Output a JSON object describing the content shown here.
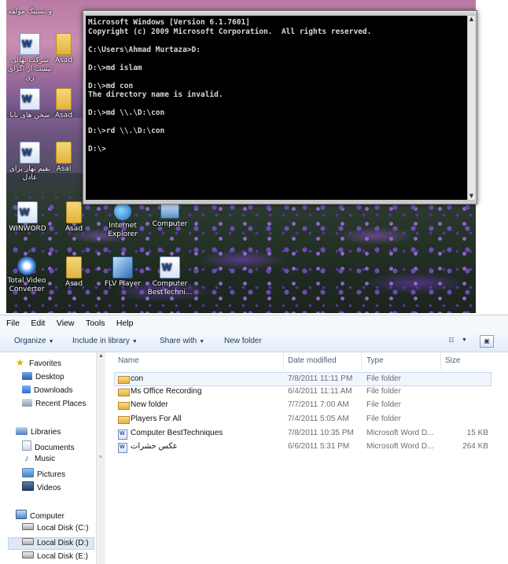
{
  "desktop": {
    "top_caption": "و تستیک مولفه",
    "icons": [
      {
        "label": "شرکت نهالی نیست ار اگرای ری",
        "kind": "word"
      },
      {
        "label": "Asad",
        "kind": "folder"
      },
      {
        "label": "سخن های نابا",
        "kind": "word"
      },
      {
        "label": "Asad",
        "kind": "folder"
      },
      {
        "label": "تقیم نهار برای عادل",
        "kind": "word"
      },
      {
        "label": "Asal",
        "kind": "folder"
      },
      {
        "label": "WINWORD",
        "kind": "word"
      },
      {
        "label": "Asad",
        "kind": "folder"
      },
      {
        "label": "Internet Explorer",
        "kind": "ie"
      },
      {
        "label": "Computer",
        "kind": "computer"
      },
      {
        "label": "Total Video Converter",
        "kind": "app"
      },
      {
        "label": "Asad",
        "kind": "folder"
      },
      {
        "label": "FLV Player",
        "kind": "flv"
      },
      {
        "label": "Computer BestTechni...",
        "kind": "word"
      }
    ]
  },
  "console": {
    "lines": [
      "Microsoft Windows [Version 6.1.7601]",
      "Copyright (c) 2009 Microsoft Corporation.  All rights reserved.",
      "",
      "C:\\Users\\Ahmad Murtaza>D:",
      "",
      "D:\\>md islam",
      "",
      "D:\\>md con",
      "The directory name is invalid.",
      "",
      "D:\\>md \\\\.\\D:\\con",
      "",
      "D:\\>rd \\\\.\\D:\\con",
      "",
      "D:\\>"
    ]
  },
  "explorer": {
    "menu": [
      "File",
      "Edit",
      "View",
      "Tools",
      "Help"
    ],
    "toolbar": {
      "organize": "Organize",
      "include": "Include in library",
      "share": "Share with",
      "new_folder": "New folder"
    },
    "nav": {
      "favorites": "Favorites",
      "desktop": "Desktop",
      "downloads": "Downloads",
      "recent": "Recent Places",
      "libraries": "Libraries",
      "documents": "Documents",
      "music": "Music",
      "pictures": "Pictures",
      "videos": "Videos",
      "computer": "Computer",
      "disk_c": "Local Disk (C:)",
      "disk_d": "Local Disk (D:)",
      "disk_e": "Local Disk (E:)"
    },
    "columns": {
      "name": "Name",
      "date": "Date modified",
      "type": "Type",
      "size": "Size"
    },
    "rows": [
      {
        "name": "con",
        "date": "7/8/2011 11:11 PM",
        "type": "File folder",
        "size": "",
        "icon": "folder-icon"
      },
      {
        "name": "Ms Office Recording",
        "date": "6/4/2011 11:11 AM",
        "type": "File folder",
        "size": "",
        "icon": "folder-icon"
      },
      {
        "name": "New folder",
        "date": "7/7/2011 7:00 AM",
        "type": "File folder",
        "size": "",
        "icon": "folder-icon"
      },
      {
        "name": "Players For All",
        "date": "7/4/2011 5:05 AM",
        "type": "File folder",
        "size": "",
        "icon": "folder-icon"
      },
      {
        "name": "Computer BestTechniques",
        "date": "7/8/2011 10:35 PM",
        "type": "Microsoft Word D...",
        "size": "15 KB",
        "icon": "word-doc-icon"
      },
      {
        "name": "عکس حشرات",
        "date": "6/6/2011 5:31 PM",
        "type": "Microsoft Word D...",
        "size": "264 KB",
        "icon": "word-doc-icon"
      }
    ]
  },
  "colors": {
    "console_bg": "#000000",
    "console_text": "#d8d8d8",
    "toolbar_text": "#1e395b",
    "selection": "#dfe9f6"
  }
}
